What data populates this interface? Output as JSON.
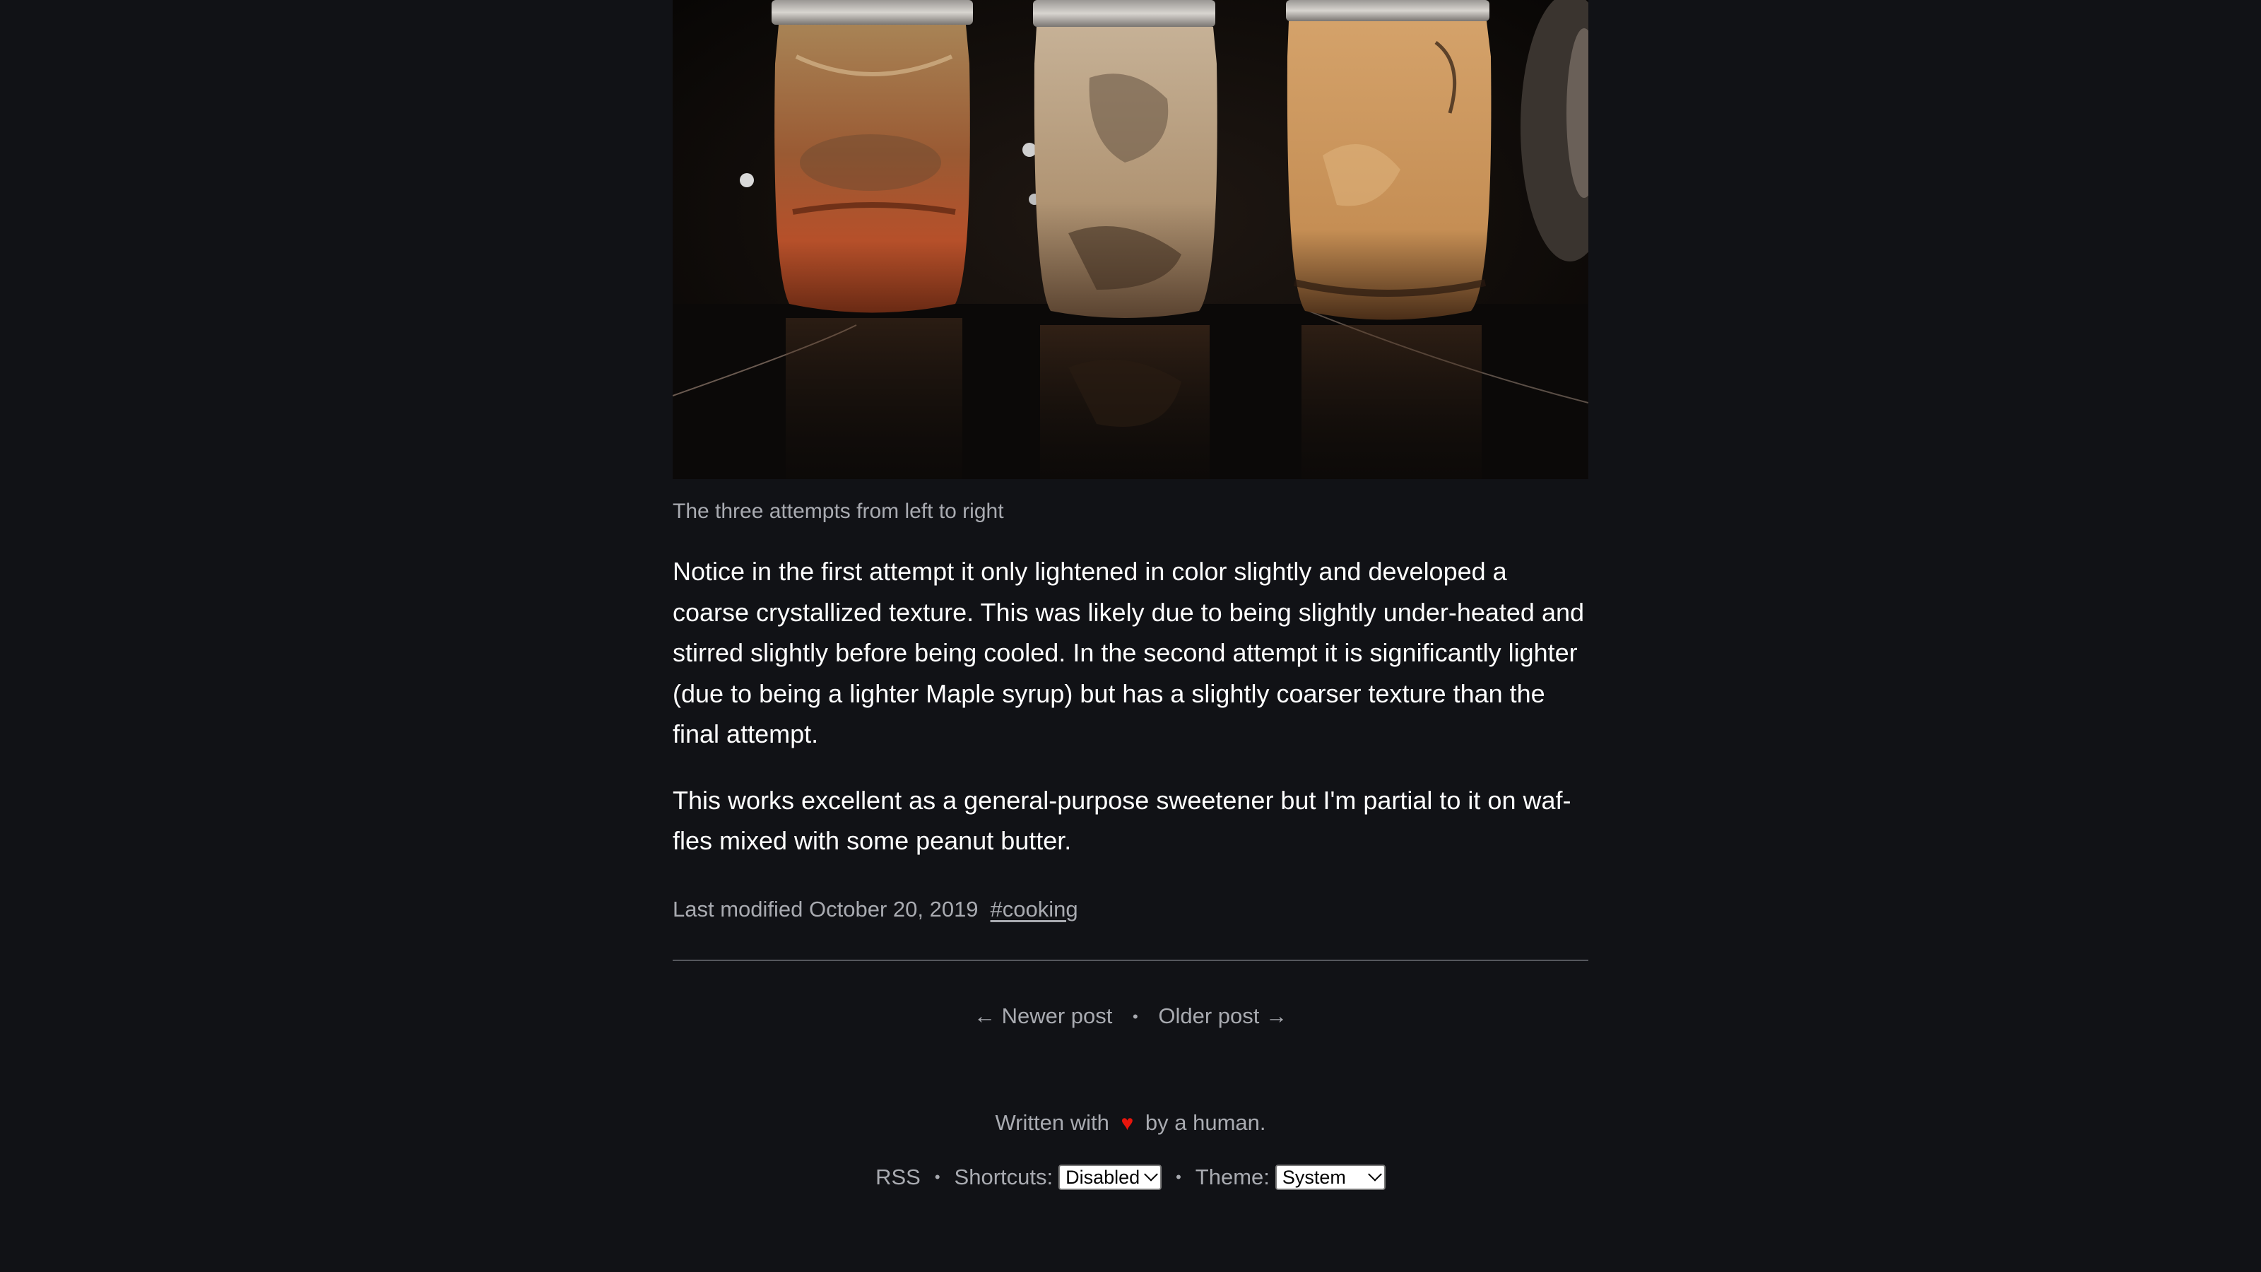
{
  "photo": {
    "caption": "The three attempts from left to right"
  },
  "body": {
    "paragraph_1": "Notice in the first attempt it only lightened in color slightly and developed a coarse crystallized texture. This was likely due to being slightly under-heated and stirred slightly before being cooled. In the second attempt it is significantly lighter (due to being a lighter Maple syrup) but has a slightly coarser texture than the final attempt.",
    "paragraph_2": "This works excellent as a general-purpose sweetener but I'm partial to it on waf­fles mixed with some peanut butter."
  },
  "meta": {
    "last_modified": "Last modified October 20, 2019",
    "tag": "#cooking"
  },
  "post_nav": {
    "newer": "← Newer post",
    "separator": "•",
    "older": "Older post →"
  },
  "footer": {
    "written_prefix": "Written with",
    "heart": "♥",
    "written_suffix": "by a human.",
    "rss": "RSS",
    "separator": "•",
    "shortcuts_label": "Shortcuts:",
    "shortcuts_value": "Disabled",
    "theme_label": "Theme:",
    "theme_value": "System"
  },
  "colors": {
    "background": "#111216",
    "text": "#ffffff",
    "muted": "#a9abb1",
    "heart": "#e8150c"
  },
  "icons": [
    "heart-icon",
    "chevron-down-icon"
  ]
}
